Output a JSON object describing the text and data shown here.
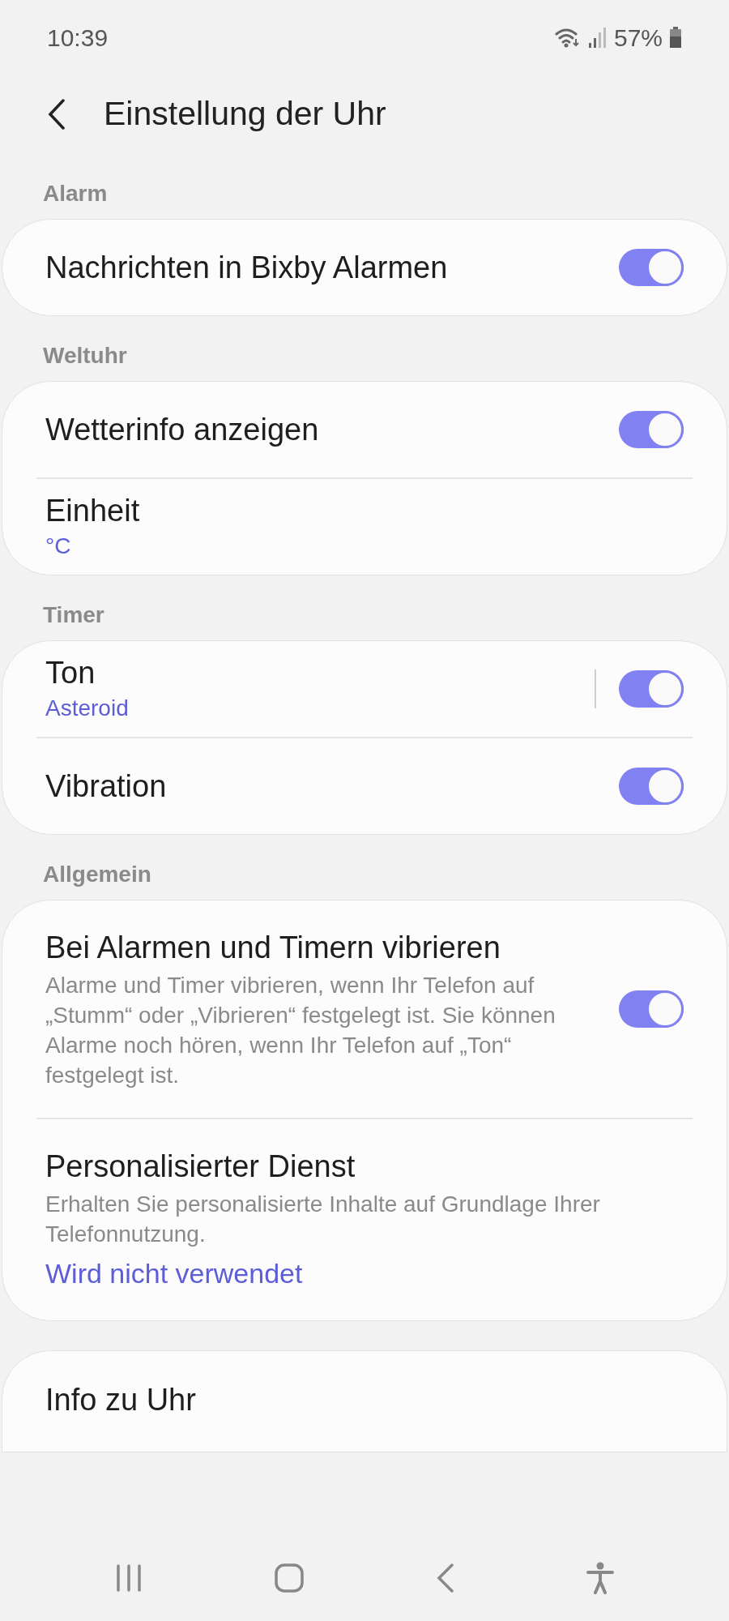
{
  "status_bar": {
    "time": "10:39",
    "battery_text": "57%"
  },
  "header": {
    "title": "Einstellung der Uhr"
  },
  "sections": [
    {
      "label": "Alarm",
      "items": [
        {
          "kind": "switch",
          "title": "Nachrichten in Bixby Alarmen",
          "checked": true
        }
      ]
    },
    {
      "label": "Weltuhr",
      "items": [
        {
          "kind": "switch",
          "title": "Wetterinfo anzeigen",
          "checked": true
        },
        {
          "kind": "value",
          "title": "Einheit",
          "value": "°C"
        }
      ]
    },
    {
      "label": "Timer",
      "items": [
        {
          "kind": "split_switch",
          "title": "Ton",
          "value": "Asteroid",
          "checked": true
        },
        {
          "kind": "switch",
          "title": "Vibration",
          "checked": true
        }
      ]
    },
    {
      "label": "Allgemein",
      "items": [
        {
          "kind": "switch",
          "title": "Bei Alarmen und Timern vibrieren",
          "summary": "Alarme und Timer vibrieren, wenn Ihr Telefon auf „Stumm“ oder „Vibrieren“ festgelegt ist. Sie können Alarme noch hören, wenn Ihr Telefon auf „Ton“ festgelegt ist.",
          "checked": true
        },
        {
          "kind": "value",
          "title": "Personalisierter Dienst",
          "summary": "Erhalten Sie personalisierte Inhalte auf Grundlage Ihrer Telefonnutzung.",
          "value": "Wird nicht verwendet"
        }
      ]
    },
    {
      "items": [
        {
          "kind": "plain",
          "title": "Info zu Uhr"
        }
      ]
    }
  ]
}
